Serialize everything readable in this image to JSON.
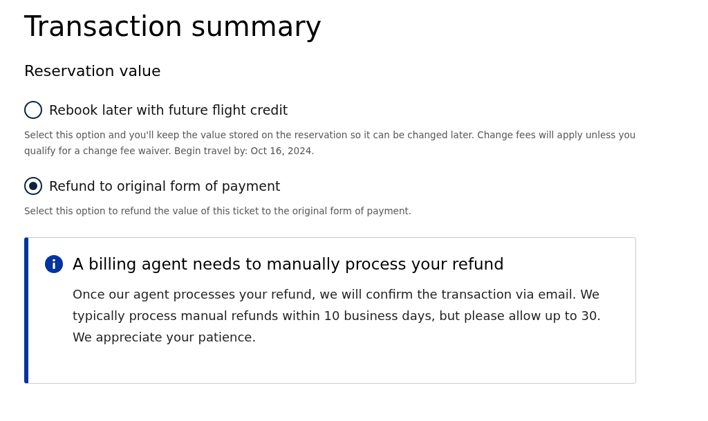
{
  "title": "Transaction summary",
  "section": {
    "heading": "Reservation value",
    "options": [
      {
        "label": "Rebook later with future flight credit",
        "selected": false,
        "description": "Select this option and you'll keep the value stored on the reservation so it can be changed later. Change fees will apply unless you qualify for a change fee waiver. Begin travel by: Oct 16, 2024."
      },
      {
        "label": "Refund to original form of payment",
        "selected": true,
        "description": "Select this option to refund the value of this ticket to the original form of payment."
      }
    ]
  },
  "alert": {
    "kind": "info",
    "heading": "A billing agent needs to manually process your refund",
    "body": "Once our agent processes your refund, we will confirm the transaction via email. We typically process manual refunds within 10 business days, but please allow up to 30. We appreciate your patience."
  }
}
